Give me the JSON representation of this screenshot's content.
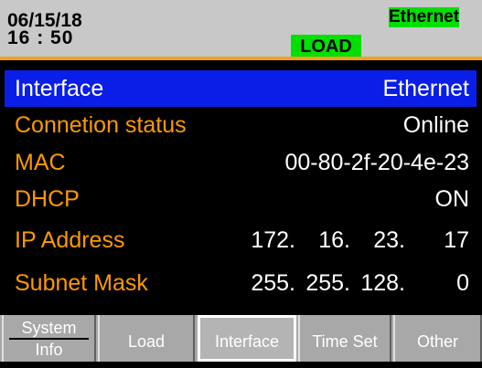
{
  "header": {
    "date": "06/15/18",
    "time": "16 : 50",
    "interface_badge": "Ethernet",
    "mode_badge": "LOAD"
  },
  "rows": [
    {
      "label": "Interface",
      "value": "Ethernet",
      "selected": true
    },
    {
      "label": "Connetion status",
      "value": "Online"
    },
    {
      "label": "MAC",
      "value": "00-80-2f-20-4e-23"
    },
    {
      "label": "DHCP",
      "value": "ON"
    },
    {
      "label": "IP Address",
      "octets": [
        "172.",
        "16.",
        "23.",
        "17"
      ]
    },
    {
      "label": "Subnet Mask",
      "octets": [
        "255.",
        "255.",
        "128.",
        "0"
      ]
    }
  ],
  "tabs": [
    {
      "label_line1": "System",
      "label_line2": "Info"
    },
    {
      "label": "Load"
    },
    {
      "label": "Interface",
      "active": true
    },
    {
      "label": "Time Set"
    },
    {
      "label": "Other"
    }
  ],
  "colors": {
    "label_orange": "#ff9900",
    "selected_bg": "#0a1ee8",
    "badge_green": "#00e000",
    "header_gray": "#c8c8c8",
    "tab_gray": "#a8a8a8"
  }
}
